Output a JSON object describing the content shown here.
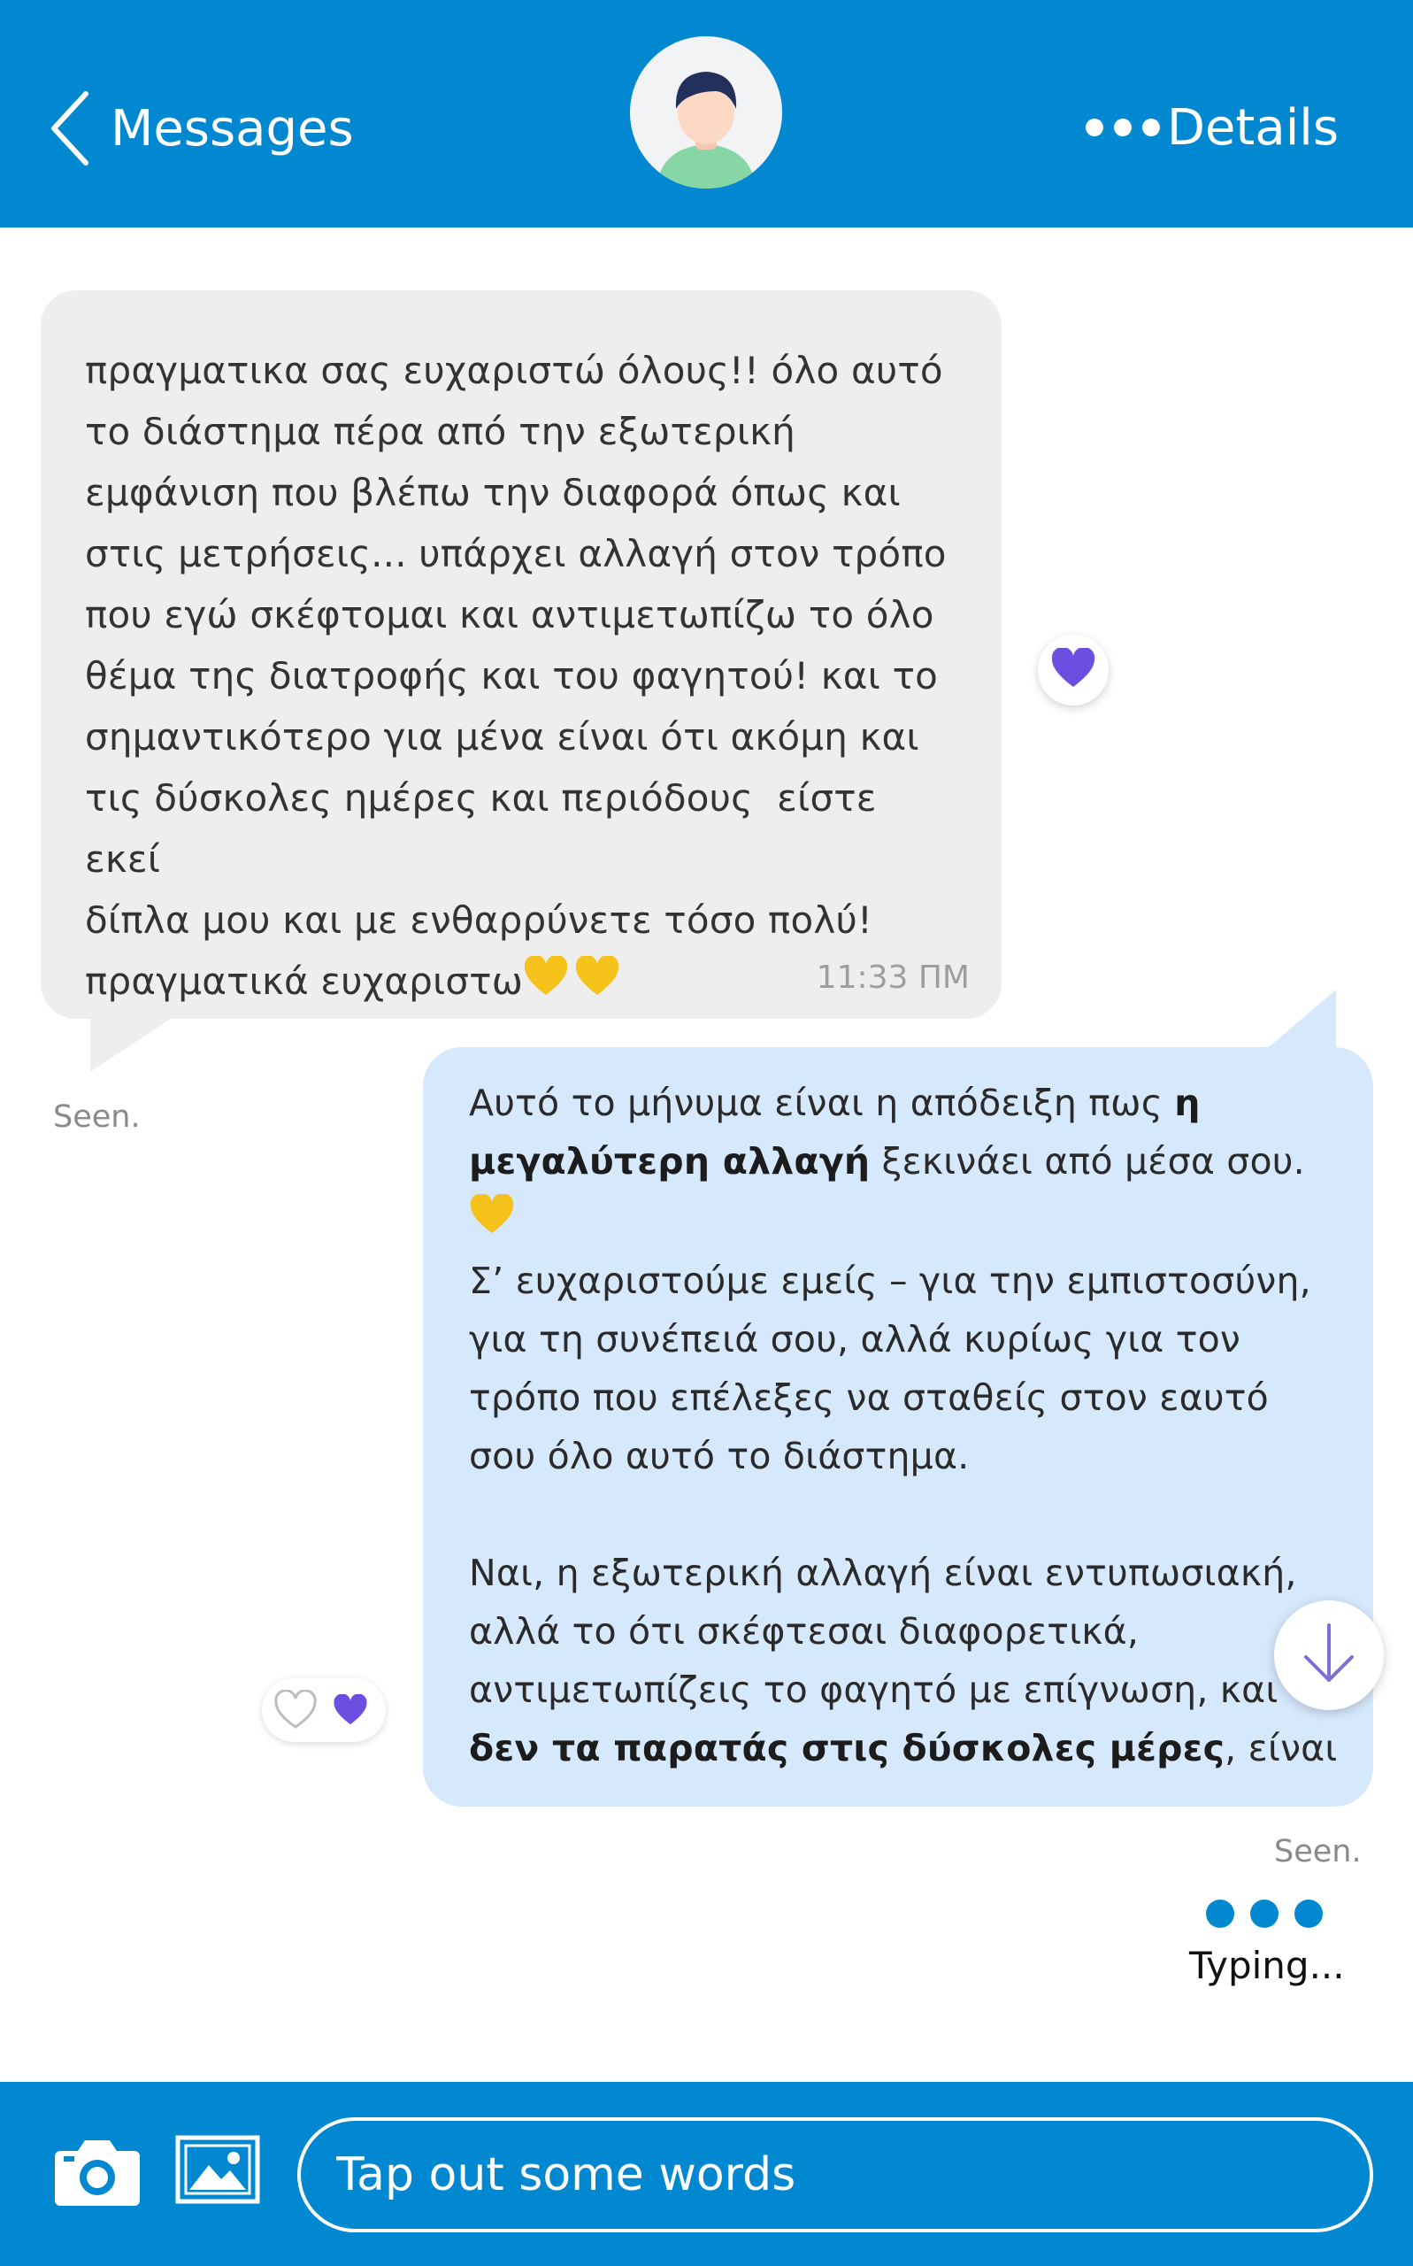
{
  "colors": {
    "primary": "#0288d1",
    "incoming_bubble": "#eeeeee",
    "outgoing_bubble": "#d6e8fc",
    "reaction_heart": "#6c4ee0",
    "yellow_heart": "#f4c21b"
  },
  "header": {
    "back_icon": "chevron-left-icon",
    "back_label": "Messages",
    "avatar_icon": "user-avatar-icon",
    "details_icon": "more-dots-icon",
    "details_label": "Details"
  },
  "messages": [
    {
      "direction": "incoming",
      "text": "πραγματικα σας ευχαριστώ όλους!! όλο αυτό\nτο διάστημα πέρα από την εξωτερική\nεμφάνιση που βλέπω την διαφορά όπως και\nστις μετρήσεις... υπάρχει αλλαγή στον τρόπο\nπου εγώ σκέφτομαι και αντιμετωπίζω το όλο\nθέμα της διατροφής και του φαγητού! και το\nσημαντικότερο για μένα είναι ότι ακόμη και\nτις δύσκολες ημέρες και περιόδους  είστε εκεί\nδίπλα μου και με ενθαρρύνετε τόσο πολύ!\nπραγματικά ευχαριστω",
      "emoji": "yellow-heart-emoji ×2",
      "time": "11:33 ΠΜ",
      "reaction": "purple-heart-icon",
      "status": "Seen."
    },
    {
      "direction": "outgoing",
      "p1_a": "Αυτό το μήνυμα είναι η απόδειξη πως ",
      "p1_b": "η μεγαλύτερη αλλαγή",
      "p1_c": " ξεκινάει από μέσα σου.",
      "p2": "Σ’ ευχαριστούμε εμείς – για την εμπιστοσύνη, για τη συνέπειά σου, αλλά κυρίως για τον τρόπο που επέλεξες να σταθείς στον εαυτό σου όλο αυτό το διάστημα.",
      "p3_a": "Ναι, η εξωτερική αλλαγή είναι εντυπωσιακή, αλλά το ότι σκέφτεσαι διαφορετικά, αντιμετωπίζεις το φαγητό με επίγνωση, και ",
      "p3_b": "δεν τα παρατάς στις δύσκολες μέρες",
      "p3_c": ", είναι",
      "reactions": [
        "heart-outline-icon",
        "purple-heart-icon"
      ],
      "status": "Seen."
    }
  ],
  "typing_indicator": {
    "label": "Typing..."
  },
  "scroll_button": {
    "icon": "arrow-down-icon"
  },
  "composer": {
    "camera_icon": "camera-icon",
    "image_icon": "image-icon",
    "placeholder": "Tap out some words",
    "value": ""
  }
}
